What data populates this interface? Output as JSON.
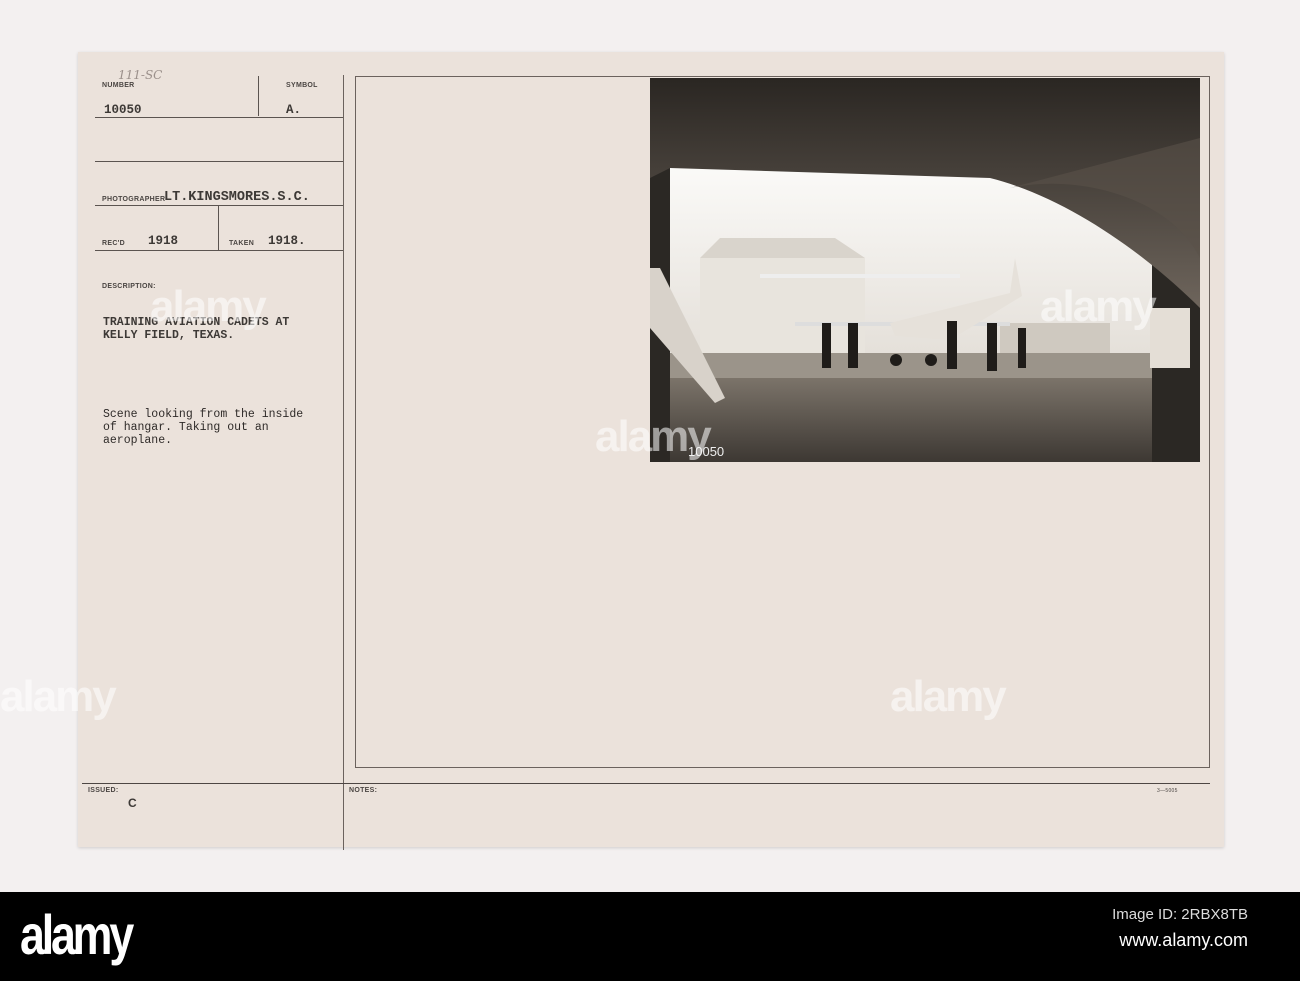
{
  "card": {
    "handwritten_ref": "111-SC",
    "number_label": "NUMBER",
    "number_value": "10050",
    "symbol_label": "SYMBOL",
    "symbol_value": "A.",
    "photographer_label": "PHOTOGRAPHER",
    "photographer_value": "LT.KINGSMORES.S.C.",
    "recd_label": "REC'D",
    "recd_value": "1918",
    "taken_label": "TAKEN",
    "taken_value": "1918.",
    "description_label": "DESCRIPTION:",
    "title_lines": [
      "TRAINING AVIATION CADETS AT",
      "KELLY FIELD, TEXAS."
    ],
    "caption_lines": [
      "Scene looking from the inside",
      "of hangar. Taking out an",
      "aeroplane."
    ],
    "issued_label": "ISSUED:",
    "issued_value": "C",
    "notes_label": "NOTES:",
    "form_number": "3—5005"
  },
  "photo": {
    "negative_number": "10050"
  },
  "footer": {
    "logo": "alamy",
    "image_id": "Image ID: 2RBX8TB",
    "url": "www.alamy.com"
  },
  "colors": {
    "card": "#ebe2db",
    "background": "#f3f0f0",
    "footer": "#000000"
  }
}
